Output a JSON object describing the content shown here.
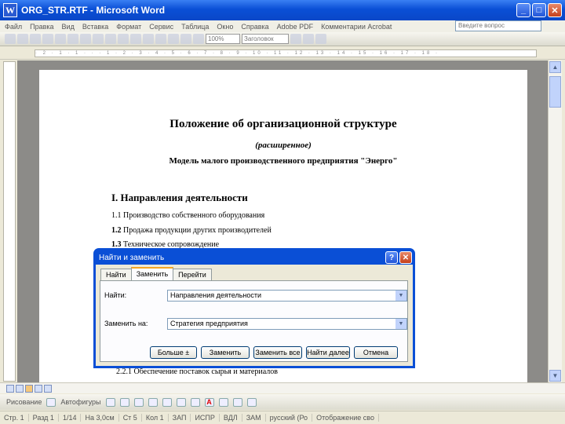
{
  "window": {
    "title": "ORG_STR.RTF - Microsoft Word",
    "icon": "W",
    "minimize": "_",
    "maximize": "□",
    "close": "✕"
  },
  "menu": {
    "items": [
      "Файл",
      "Правка",
      "Вид",
      "Вставка",
      "Формат",
      "Сервис",
      "Таблица",
      "Окно",
      "Справка",
      "Adobe PDF",
      "Комментарии Acrobat"
    ],
    "help_placeholder": "Введите вопрос"
  },
  "toolbar": {
    "zoom": "100%",
    "style": "Заголовок"
  },
  "document": {
    "title": "Положение об организационной структуре",
    "subtitle": "(расширенное)",
    "model": "Модель малого производственного предприятия \"Энерго\"",
    "section": "I. Направления деятельности",
    "items": [
      {
        "num": "1.1",
        "text": "Производство собственного оборудования"
      },
      {
        "num": "1.2",
        "text": "Продажа продукции других производителей"
      },
      {
        "num": "1.3",
        "text": "Техническое сопровождение"
      },
      {
        "num": "2.2.1",
        "text": "Обеспечение поставок сырья и материалов"
      }
    ]
  },
  "dialog": {
    "title": "Найти и заменить",
    "help": "?",
    "close": "✕",
    "tabs": [
      "Найти",
      "Заменить",
      "Перейти"
    ],
    "active_tab": "Заменить",
    "find_label": "Найти:",
    "find_value": "Направления деятельности",
    "replace_label": "Заменить на:",
    "replace_value": "Стратегия предприятия",
    "buttons": {
      "more": "Больше ±",
      "replace": "Заменить",
      "replace_all": "Заменить все",
      "find_next": "Найти далее",
      "cancel": "Отмена"
    }
  },
  "drawbar": {
    "draw": "Рисование",
    "autoshapes": "Автофигуры"
  },
  "status": {
    "page": "Стр. 1",
    "section": "Разд 1",
    "pages": "1/14",
    "at": "На 3,0см",
    "line": "Ст 5",
    "col": "Кол 1",
    "rec": "ЗАП",
    "trk": "ИСПР",
    "ext": "ВДЛ",
    "ovr": "ЗАМ",
    "lang": "русский (Ро",
    "compat": "Отображение сво"
  }
}
